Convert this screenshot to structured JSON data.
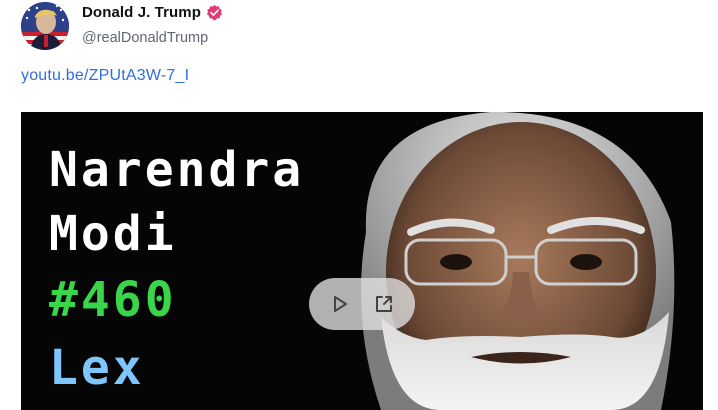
{
  "post": {
    "author_name": "Donald J. Trump",
    "author_handle": "@realDonaldTrump",
    "link_text": "youtu.be/ZPUtA3W-7_I"
  },
  "video": {
    "title_line1": "Narendra",
    "title_line2": "Modi",
    "episode": "#460",
    "host": "Lex"
  },
  "icons": {
    "verified": "verified-badge-icon",
    "play": "play-icon",
    "external": "external-link-icon"
  },
  "colors": {
    "link": "#2f6ee0",
    "verified": "#e53a7a",
    "episode": "#39d64a",
    "host": "#7fc6ff"
  }
}
